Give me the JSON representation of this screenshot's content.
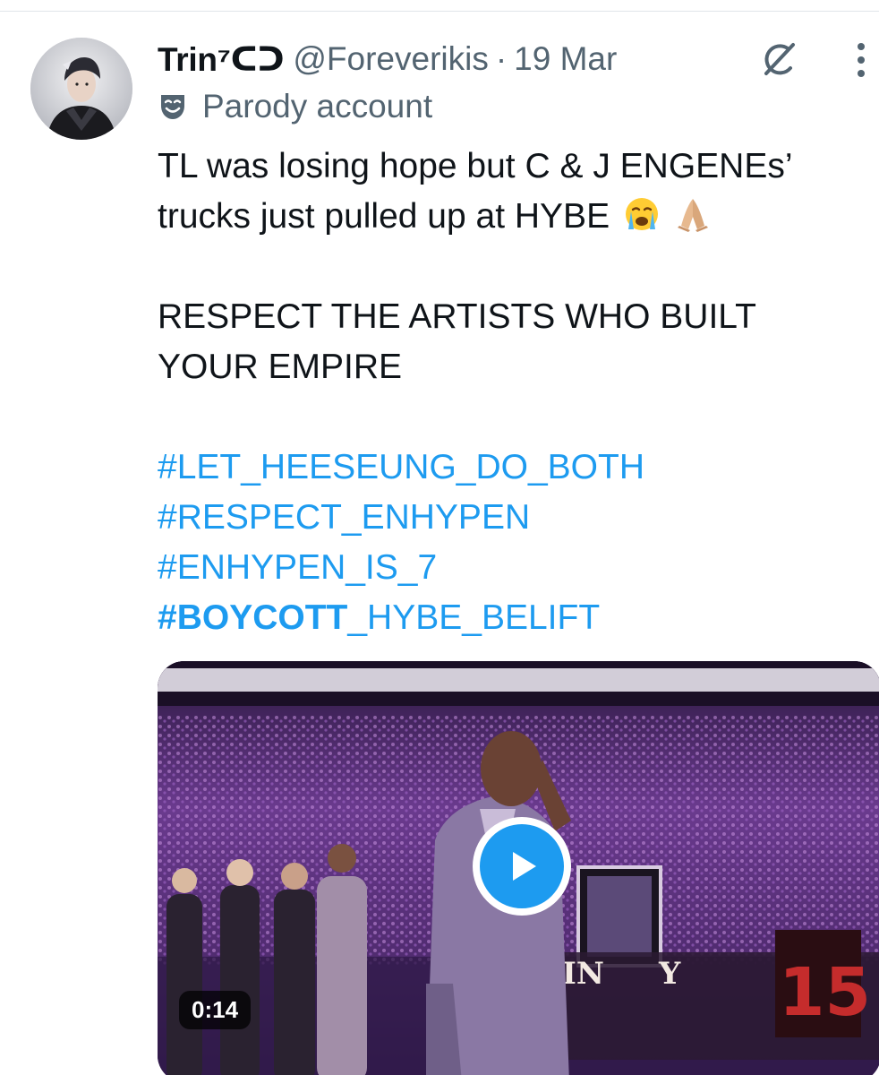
{
  "author": {
    "display_name": "Trin⁷ᑕᑐ",
    "handle": "@Foreverikis",
    "separator": "·",
    "timestamp": "19 Mar",
    "label": "Parody account"
  },
  "icons": {
    "avatar": "avatar",
    "grok": "grok-icon",
    "more": "more-icon",
    "parody": "theater-masks-icon",
    "play": "play-icon"
  },
  "tweet": {
    "line1": "TL was losing hope but C & J ENGENEs’",
    "line2": "trucks just pulled up at HYBE",
    "emojis": [
      "loudly-crying-face",
      "folded-hands"
    ],
    "line3": "RESPECT THE ARTISTS WHO BUILT",
    "line4": "YOUR EMPIRE",
    "hashtags": [
      "#LET_HEESEUNG_DO_BOTH",
      "#RESPECT_ENHYPEN",
      "#ENHYPEN_IS_7"
    ],
    "hashtag4_bold": "#BOYCOTT",
    "hashtag4_rest": "_HYBE_BELIFT"
  },
  "media": {
    "duration": "0:14",
    "banner_left": "IN",
    "banner_right": "Y",
    "jersey_number": "15"
  },
  "colors": {
    "link": "#1d9bf0",
    "secondary_text": "#536471",
    "primary_text": "#0f1419"
  }
}
